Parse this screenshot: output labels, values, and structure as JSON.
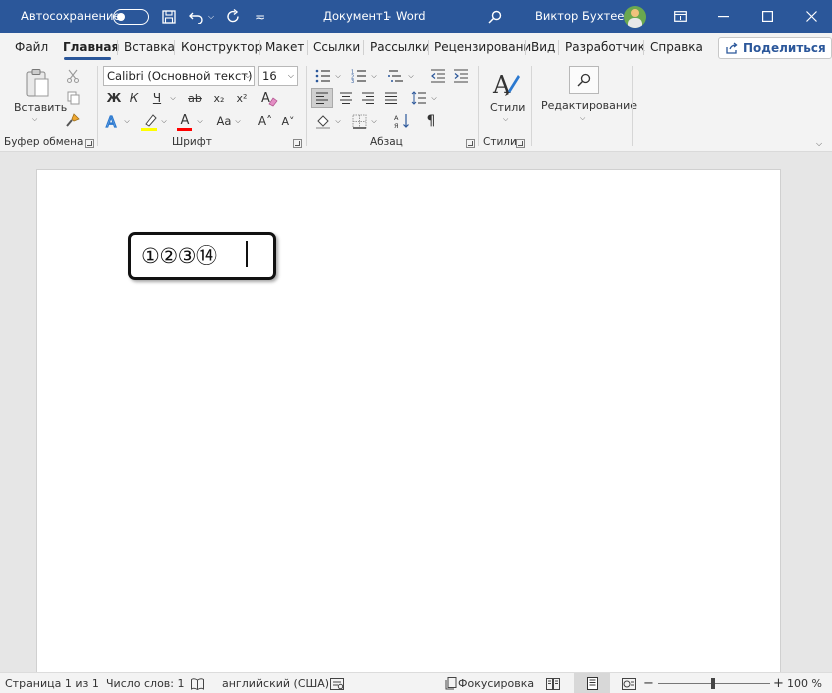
{
  "titlebar": {
    "autosave_label": "Автосохранение",
    "document_title": "Документ1",
    "separator": "-",
    "app_name": "Word",
    "user_name": "Виктор Бухтеев"
  },
  "tabs": [
    {
      "label": "Файл"
    },
    {
      "label": "Главная"
    },
    {
      "label": "Вставка"
    },
    {
      "label": "Конструктор"
    },
    {
      "label": "Макет"
    },
    {
      "label": "Ссылки"
    },
    {
      "label": "Рассылки"
    },
    {
      "label": "Рецензировани"
    },
    {
      "label": "Вид"
    },
    {
      "label": "Разработчик"
    },
    {
      "label": "Справка"
    }
  ],
  "share_label": "Поделиться",
  "ribbon": {
    "clipboard": {
      "paste_label": "Вставить",
      "group_label": "Буфер обмена"
    },
    "font": {
      "font_name": "Calibri (Основной текст)",
      "font_size": "16",
      "bold": "Ж",
      "italic": "К",
      "underline": "Ч",
      "strike": "ab",
      "subscript": "x₂",
      "superscript": "x²",
      "case": "Aa",
      "grow": "A˄",
      "shrink": "A˅",
      "group_label": "Шрифт"
    },
    "paragraph": {
      "group_label": "Абзац"
    },
    "styles": {
      "label": "Стили",
      "group_label": "Стили"
    },
    "editing": {
      "label": "Редактирование"
    }
  },
  "document": {
    "content": "①②③⑭"
  },
  "statusbar": {
    "page_info": "Страница 1 из 1",
    "word_count": "Число слов: 1",
    "language": "английский (США)",
    "focus": "Фокусировка",
    "zoom": "100 %"
  },
  "colors": {
    "brand": "#2b579a",
    "highlight_yellow": "#ffff00",
    "font_color_red": "#ff0000"
  }
}
